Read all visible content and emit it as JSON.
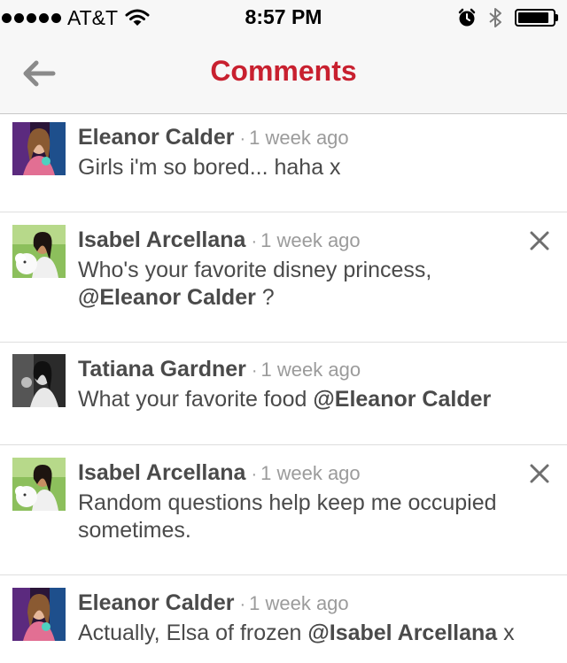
{
  "status_bar": {
    "carrier": "AT&T",
    "time": "8:57 PM",
    "icons": [
      "signal-dots-icon",
      "wifi-icon",
      "alarm-icon",
      "bluetooth-icon",
      "battery-icon"
    ],
    "battery_level": 0.9
  },
  "nav": {
    "title": "Comments",
    "back_icon": "back-arrow-icon",
    "title_color": "#c8202f"
  },
  "comments": [
    {
      "author": "Eleanor Calder",
      "separator": "·",
      "time": "1 week ago",
      "text_before": "Girls i'm so bored... haha x",
      "mention": "",
      "text_after": "",
      "deletable": false
    },
    {
      "author": "Isabel Arcellana",
      "separator": "·",
      "time": "1 week ago",
      "text_before": "Who's your favorite disney princess,",
      "mention": "@Eleanor Calder",
      "text_after": " ?",
      "deletable": true
    },
    {
      "author": "Tatiana Gardner",
      "separator": "·",
      "time": "1 week ago",
      "text_before": "What your favorite food ",
      "mention": "@Eleanor Calder",
      "text_after": "",
      "deletable": false
    },
    {
      "author": "Isabel Arcellana",
      "separator": "·",
      "time": "1 week ago",
      "text_before": "Random questions help keep me occupied sometimes.",
      "mention": "",
      "text_after": "",
      "deletable": true
    },
    {
      "author": "Eleanor Calder",
      "separator": "·",
      "time": "1 week ago",
      "text_before": "Actually, Elsa of frozen ",
      "mention": "@Isabel Arcellana",
      "text_after": " x",
      "deletable": false
    }
  ]
}
